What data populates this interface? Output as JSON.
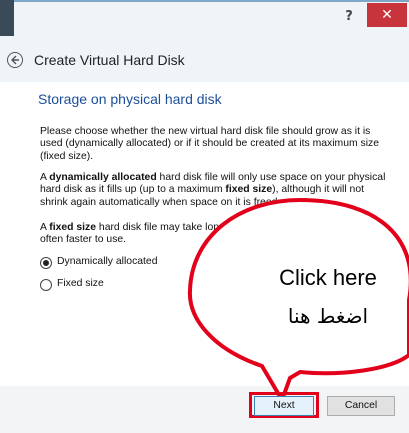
{
  "window": {
    "help_label": "?",
    "close_label": "✕"
  },
  "dialog": {
    "title": "Create Virtual Hard Disk"
  },
  "section": {
    "title": "Storage on physical hard disk"
  },
  "paragraphs": {
    "p1": "Please choose whether the new virtual hard disk file should grow as it is used (dynamically allocated) or if it should be created at its maximum size (fixed size).",
    "p2_a": "A ",
    "p2_b": "dynamically allocated",
    "p2_c": " hard disk file will only use space on your physical hard disk as it fills up (up to a maximum ",
    "p2_d": "fixed size",
    "p2_e": "), although it will not shrink again automatically when space on it is freed.",
    "p3_a": "A ",
    "p3_b": "fixed size",
    "p3_c": " hard disk file may take longer to create on some systems but is often faster to use."
  },
  "options": [
    {
      "label": "Dynamically allocated",
      "selected": true
    },
    {
      "label": "Fixed size",
      "selected": false
    }
  ],
  "buttons": {
    "next": "Next",
    "cancel": "Cancel"
  },
  "callout": {
    "line1": "Click here",
    "line2": "اضغط هنا",
    "outline_color": "#e3001b"
  }
}
